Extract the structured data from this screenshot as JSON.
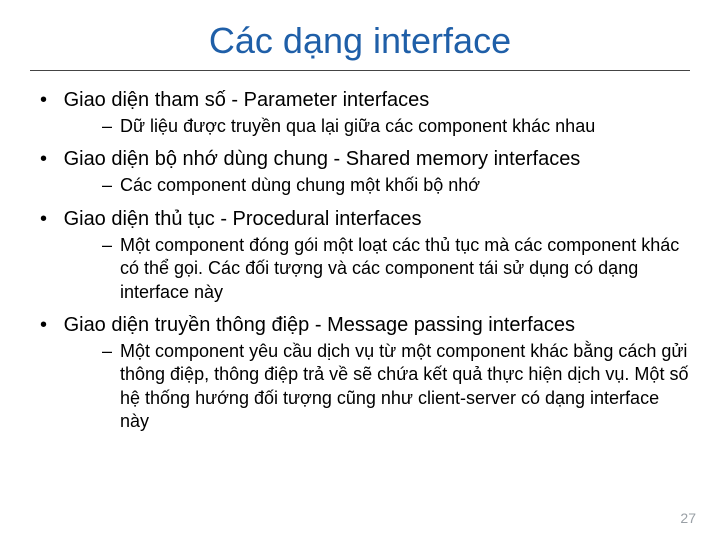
{
  "title": "Các dạng interface",
  "bullets": [
    {
      "text": "Giao diện tham số - Parameter interfaces",
      "sub": [
        "Dữ liệu được truyền qua lại giữa các component khác nhau"
      ]
    },
    {
      "text": "Giao diện bộ nhớ dùng chung - Shared memory interfaces",
      "sub": [
        "Các component dùng chung một khối bộ nhớ"
      ]
    },
    {
      "text": "Giao diện thủ tục - Procedural interfaces",
      "sub": [
        "Một component đóng gói một loạt các thủ tục mà các component khác có thể gọi. Các đối tượng và các component tái sử dụng có dạng interface này"
      ]
    },
    {
      "text": "Giao diện truyền thông điệp - Message passing interfaces",
      "sub": [
        "Một component yêu cầu dịch vụ từ một component khác bằng cách gửi thông điệp, thông điệp trả về sẽ chứa kết quả thực hiện dịch vụ. Một số hệ thống hướng đối tượng cũng như client-server có dạng interface này"
      ]
    }
  ],
  "page_number": "27"
}
